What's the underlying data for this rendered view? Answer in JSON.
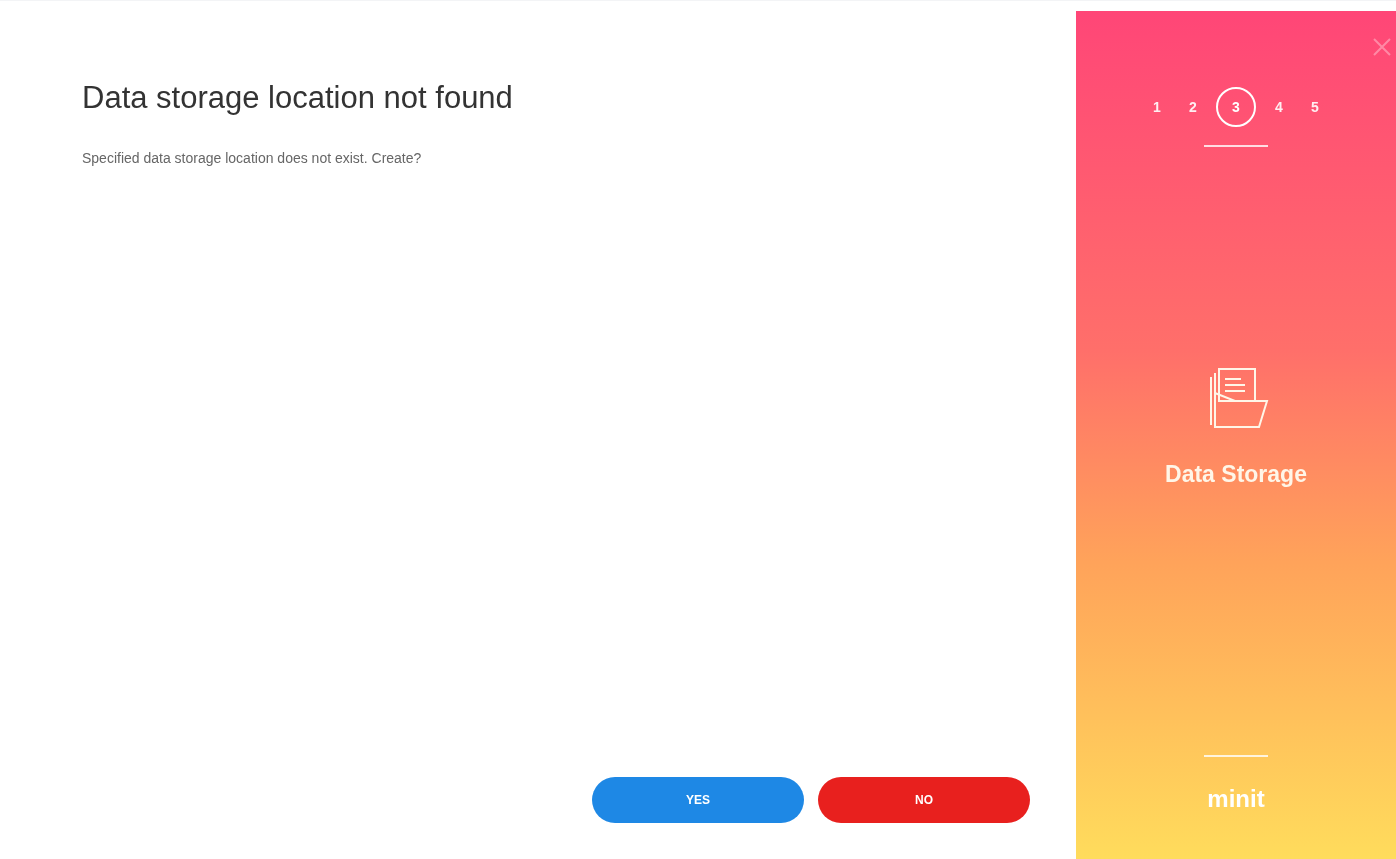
{
  "dialog": {
    "title": "Data storage location not found",
    "message": "Specified data storage location does not exist. Create?"
  },
  "buttons": [
    {
      "label": "YES",
      "kind": "confirm"
    },
    {
      "label": "NO",
      "kind": "cancel"
    }
  ],
  "steps": [
    {
      "label": "1",
      "selected": false
    },
    {
      "label": "2",
      "selected": false
    },
    {
      "label": "3",
      "selected": true
    },
    {
      "label": "4",
      "selected": false
    },
    {
      "label": "5",
      "selected": false
    }
  ],
  "side_panel": {
    "title": "Data Storage",
    "logo": "minit"
  }
}
